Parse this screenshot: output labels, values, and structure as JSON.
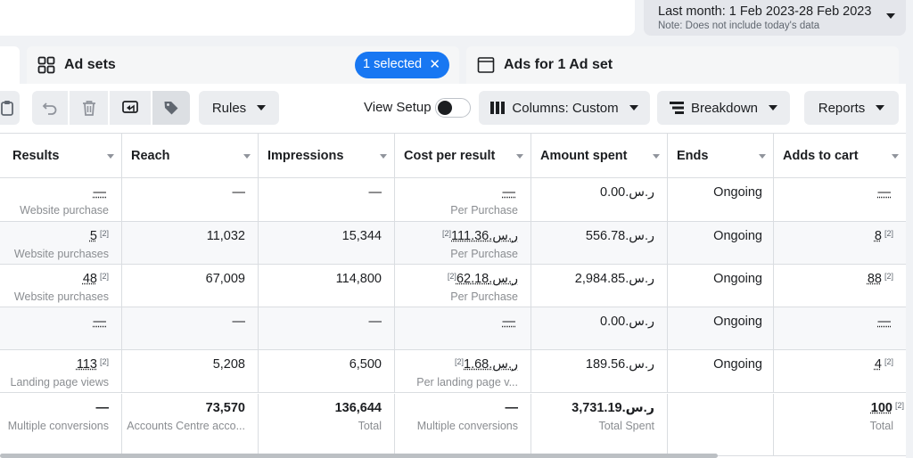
{
  "date_range": {
    "label": "Last month: 1 Feb 2023-28 Feb 2023",
    "note": "Note: Does not include today's data"
  },
  "tabs": {
    "ad_sets": {
      "label": "Ad sets",
      "selected_pill": "1 selected",
      "pill_close": "✕"
    },
    "ads": {
      "label": "Ads for 1 Ad set"
    }
  },
  "toolbar": {
    "rules_label": "Rules",
    "view_setup_label": "View Setup",
    "view_setup_on": false,
    "columns_label": "Columns: Custom",
    "breakdown_label": "Breakdown",
    "reports_label": "Reports"
  },
  "table": {
    "columns": [
      "Results",
      "Reach",
      "Impressions",
      "Cost per result",
      "Amount spent",
      "Ends",
      "Adds to cart"
    ],
    "rows": [
      {
        "results": "—",
        "results_sup": "",
        "results_sub": "Website purchase",
        "reach": "—",
        "impressions": "—",
        "cost": "—",
        "cost_sup": "",
        "cost_sub": "Per Purchase",
        "spent": "ر.س.0.00",
        "ends": "Ongoing",
        "adds": "—",
        "adds_sup": ""
      },
      {
        "results": "5",
        "results_sup": "[2]",
        "results_sub": "Website purchases",
        "reach": "11,032",
        "impressions": "15,344",
        "cost": "ر.س.111.36",
        "cost_sup": "[2]",
        "cost_sub": "Per Purchase",
        "spent": "ر.س.556.78",
        "ends": "Ongoing",
        "adds": "8",
        "adds_sup": "[2]"
      },
      {
        "results": "48",
        "results_sup": "[2]",
        "results_sub": "Website purchases",
        "reach": "67,009",
        "impressions": "114,800",
        "cost": "ر.س.62.18",
        "cost_sup": "[2]",
        "cost_sub": "Per Purchase",
        "spent": "ر.س.2,984.85",
        "ends": "Ongoing",
        "adds": "88",
        "adds_sup": "[2]"
      },
      {
        "results": "—",
        "results_sup": "",
        "results_sub": "",
        "reach": "—",
        "impressions": "—",
        "cost": "—",
        "cost_sup": "",
        "cost_sub": "",
        "spent": "ر.س.0.00",
        "ends": "Ongoing",
        "adds": "—",
        "adds_sup": ""
      },
      {
        "results": "113",
        "results_sup": "[2]",
        "results_sub": "Landing page views",
        "reach": "5,208",
        "impressions": "6,500",
        "cost": "ر.س.1.68",
        "cost_sup": "[2]",
        "cost_sub": "Per landing page v...",
        "spent": "ر.س.189.56",
        "ends": "Ongoing",
        "adds": "4",
        "adds_sup": "[2]"
      }
    ],
    "totals": {
      "results": "—",
      "results_sub": "Multiple conversions",
      "reach": "73,570",
      "reach_sub": "Accounts Centre acco...",
      "impressions": "136,644",
      "impressions_sub": "Total",
      "cost": "—",
      "cost_sub": "Multiple conversions",
      "spent": "ر.س.3,731.19",
      "spent_sub": "Total Spent",
      "adds": "100",
      "adds_sup": "[2]",
      "adds_sub": "Total"
    }
  }
}
